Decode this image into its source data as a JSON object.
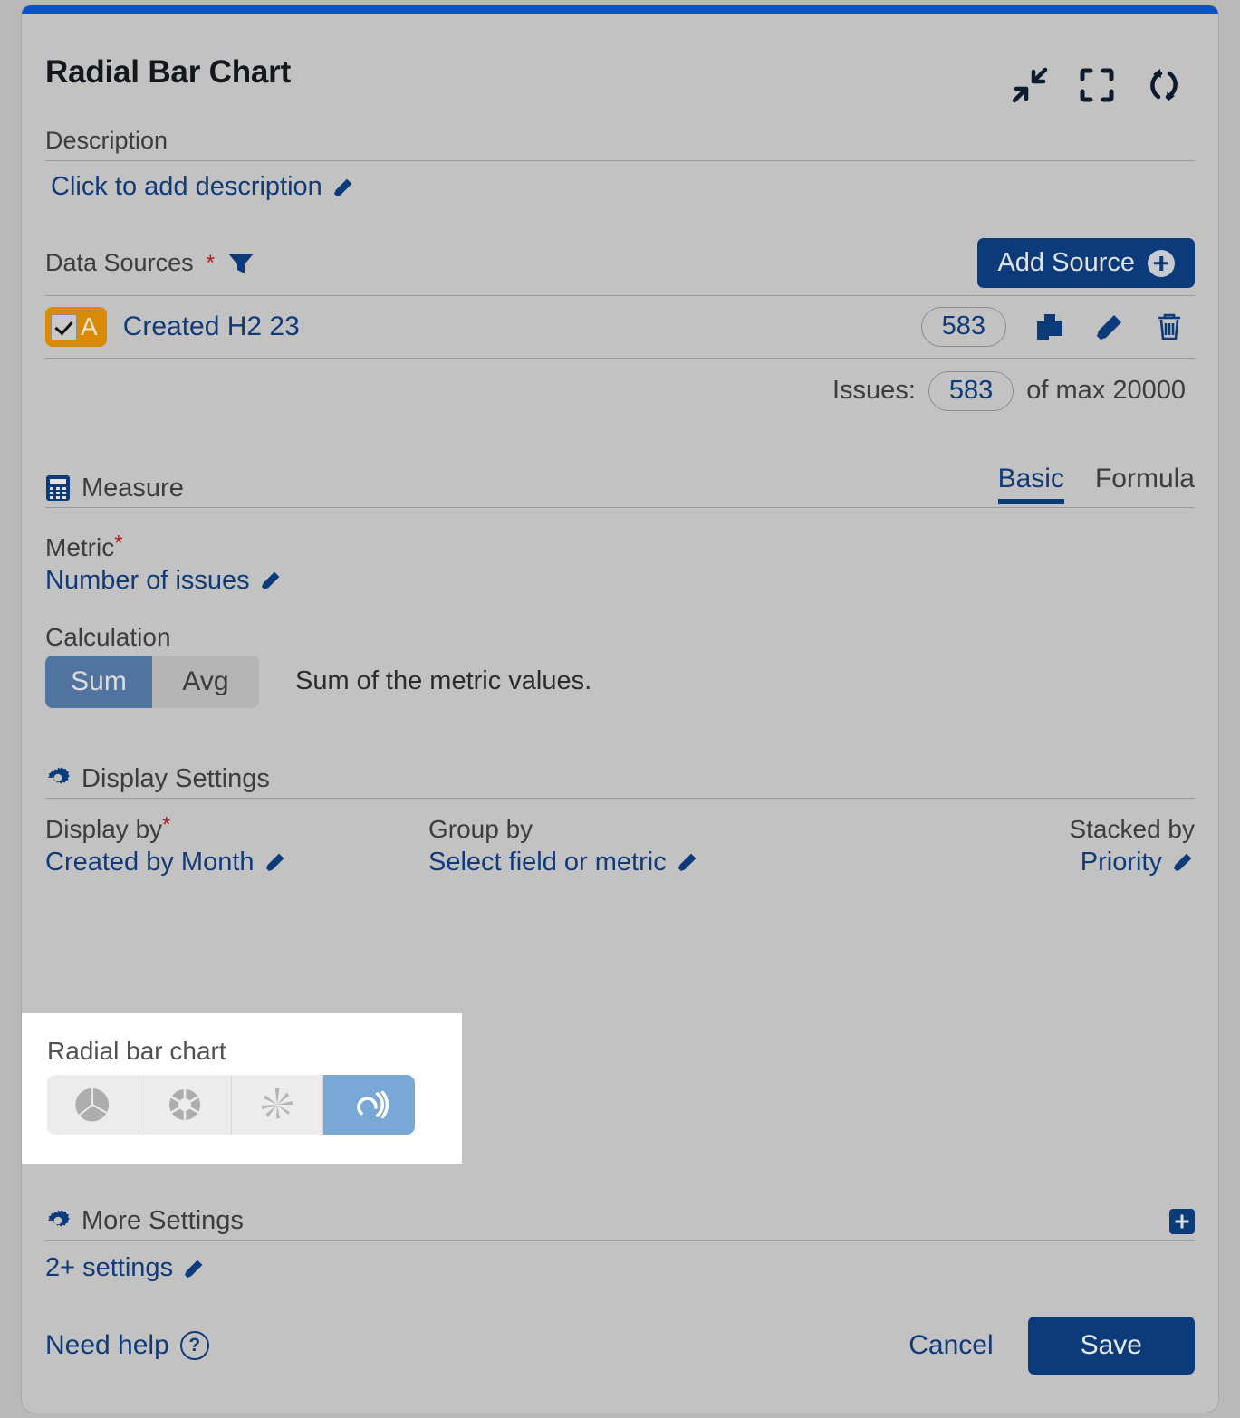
{
  "window": {
    "title": "Radial Bar Chart",
    "accent_color": "#0b50c6",
    "header_icons": [
      {
        "name": "collapse-icon",
        "label": "Collapse"
      },
      {
        "name": "fullscreen-icon",
        "label": "Fullscreen"
      },
      {
        "name": "refresh-icon",
        "label": "Refresh"
      }
    ]
  },
  "description": {
    "label": "Description",
    "value": "Click to add description"
  },
  "data_sources": {
    "label": "Data Sources",
    "required_marker": "*",
    "add_button": "Add Source",
    "rows": [
      {
        "letter": "A",
        "name": "Created H2 23",
        "count": "583",
        "checked": true,
        "badge_color": "#d98b08"
      }
    ],
    "issues_label": "Issues:",
    "issues_count": "583",
    "issues_max_text": "of max 20000"
  },
  "measure": {
    "title": "Measure",
    "tabs": [
      {
        "label": "Basic",
        "active": true
      },
      {
        "label": "Formula",
        "active": false
      }
    ],
    "metric_label": "Metric",
    "metric_required": "*",
    "metric_value": "Number of issues",
    "calculation_label": "Calculation",
    "calculation_options": [
      {
        "label": "Sum",
        "selected": true
      },
      {
        "label": "Avg",
        "selected": false
      }
    ],
    "calculation_description": "Sum of the metric values."
  },
  "display_settings": {
    "title": "Display Settings",
    "display_by_label": "Display by",
    "display_by_required": "*",
    "display_by_value": "Created by Month",
    "group_by_label": "Group by",
    "group_by_value": "Select field or metric",
    "stacked_by_label": "Stacked by",
    "stacked_by_value": "Priority"
  },
  "chart_type_popup": {
    "title": "Radial bar chart",
    "selected_color": "#79a7d6",
    "options": [
      {
        "name": "pie-chart-icon",
        "label": "Pie chart",
        "selected": false
      },
      {
        "name": "donut-chart-icon",
        "label": "Donut chart",
        "selected": false
      },
      {
        "name": "polar-chart-icon",
        "label": "Polar chart",
        "selected": false
      },
      {
        "name": "radial-bar-chart-icon",
        "label": "Radial bar chart",
        "selected": true
      }
    ]
  },
  "more_settings": {
    "title": "More Settings",
    "value": "2+ settings"
  },
  "footer": {
    "need_help": "Need help",
    "cancel": "Cancel",
    "save": "Save"
  }
}
